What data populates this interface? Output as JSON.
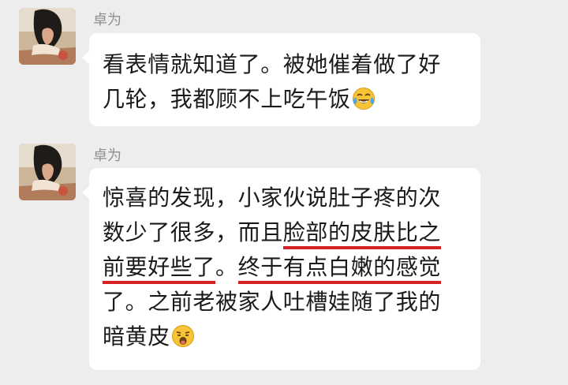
{
  "messages": [
    {
      "sender": "卓为",
      "lines": [
        {
          "segments": [
            {
              "text": "看表情就知道了。被她催着做了好",
              "underline": false
            }
          ]
        },
        {
          "segments": [
            {
              "text": "几轮，我都顾不上吃午饭",
              "underline": false
            }
          ],
          "emoji": "crying-laughing-emoji"
        }
      ]
    },
    {
      "sender": "卓为",
      "lines": [
        {
          "segments": [
            {
              "text": "惊喜的发现，小家伙说肚子疼的次",
              "underline": false
            }
          ]
        },
        {
          "segments": [
            {
              "text": "数少了很多，而且",
              "underline": false
            },
            {
              "text": "脸部的皮肤比之",
              "underline": true
            }
          ]
        },
        {
          "segments": [
            {
              "text": "前要好些了",
              "underline": true
            },
            {
              "text": "。",
              "underline": false
            },
            {
              "text": "终于有点白嫩的感觉",
              "underline": true
            }
          ]
        },
        {
          "segments": [
            {
              "text": "了。之前老被家人吐槽娃随了我的",
              "underline": false
            }
          ]
        },
        {
          "segments": [
            {
              "text": "暗黄皮",
              "underline": false
            }
          ],
          "emoji": "shocked-face-emoji"
        }
      ]
    }
  ],
  "colors": {
    "background": "#ededed",
    "bubble": "#ffffff",
    "sender_name": "#8f8f8f",
    "underline": "#d71f26"
  }
}
